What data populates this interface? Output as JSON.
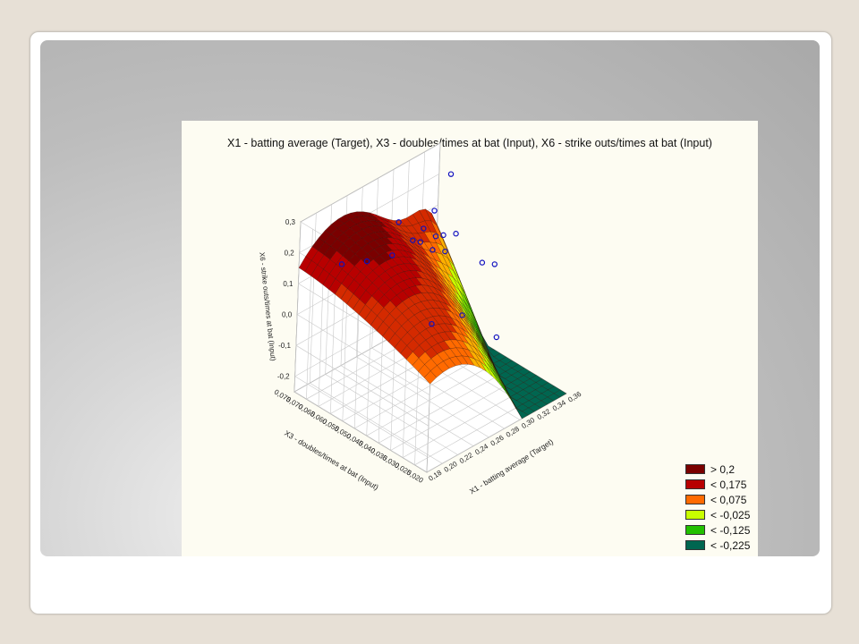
{
  "chart_data": {
    "type": "surface3d",
    "title": "X1 - batting average (Target), X3 - doubles/times at bat (Input), X6 - strike outs/times at bat (Input)",
    "xlabel": "X1 - batting average (Target)",
    "ylabel": "X3 - doubles/times at bat (Input)",
    "zlabel": "X6 - strike outs/times at bat (Input)",
    "x_ticks": [
      "0,18",
      "0,20",
      "0,22",
      "0,24",
      "0,26",
      "0,28",
      "0,30",
      "0,32",
      "0,34",
      "0,36"
    ],
    "y_ticks": [
      "0,020",
      "0,025",
      "0,030",
      "0,035",
      "0,040",
      "0,045",
      "0,050",
      "0,055",
      "0,060",
      "0,065",
      "0,070",
      "0,075"
    ],
    "z_ticks": [
      "-0,2",
      "-0,1",
      "0,0",
      "0,1",
      "0,2",
      "0,3"
    ],
    "xlim": [
      0.18,
      0.36
    ],
    "ylim": [
      0.02,
      0.075
    ],
    "zlim": [
      -0.25,
      0.3
    ],
    "grid": true,
    "legend_position": "bottom-right",
    "legend": [
      {
        "label": "> 0,2",
        "color": "#7a0000"
      },
      {
        "label": "< 0,175",
        "color": "#b80000"
      },
      {
        "label": "< 0,075",
        "color": "#ff6a00"
      },
      {
        "label": "< -0,025",
        "color": "#c8ff00"
      },
      {
        "label": "< -0,125",
        "color": "#22c000"
      },
      {
        "label": "< -0,225",
        "color": "#006650"
      }
    ],
    "surface_estimate": "approximately z = 0.30 at x=0.36,y=0.075; ridge ~0.13 toward x=0.24; -0.22 near x=0.36,y=0.020",
    "points": [
      {
        "x": 0.22,
        "y": 0.07,
        "z": 0.13
      },
      {
        "x": 0.24,
        "y": 0.066,
        "z": 0.13
      },
      {
        "x": 0.26,
        "y": 0.062,
        "z": 0.14
      },
      {
        "x": 0.28,
        "y": 0.066,
        "z": 0.2
      },
      {
        "x": 0.28,
        "y": 0.06,
        "z": 0.17
      },
      {
        "x": 0.29,
        "y": 0.06,
        "z": 0.15
      },
      {
        "x": 0.3,
        "y": 0.062,
        "z": 0.17
      },
      {
        "x": 0.3,
        "y": 0.058,
        "z": 0.12
      },
      {
        "x": 0.31,
        "y": 0.06,
        "z": 0.14
      },
      {
        "x": 0.31,
        "y": 0.056,
        "z": 0.11
      },
      {
        "x": 0.32,
        "y": 0.06,
        "z": 0.13
      },
      {
        "x": 0.32,
        "y": 0.064,
        "z": 0.19
      },
      {
        "x": 0.33,
        "y": 0.058,
        "z": 0.13
      },
      {
        "x": 0.34,
        "y": 0.064,
        "z": 0.28
      },
      {
        "x": 0.34,
        "y": 0.05,
        "z": 0.06
      },
      {
        "x": 0.35,
        "y": 0.048,
        "z": 0.05
      },
      {
        "x": 0.27,
        "y": 0.048,
        "z": -0.03
      },
      {
        "x": 0.3,
        "y": 0.045,
        "z": -0.03
      },
      {
        "x": 0.33,
        "y": 0.04,
        "z": -0.12
      }
    ]
  }
}
